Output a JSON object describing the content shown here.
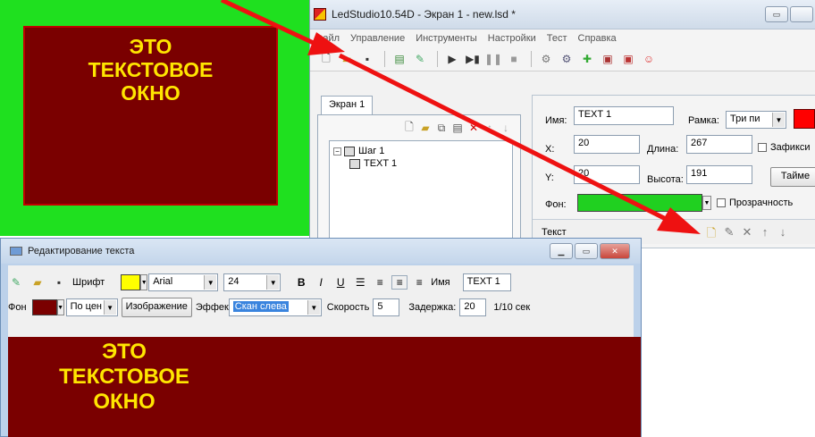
{
  "led_preview": {
    "lines": [
      "ЭТО",
      "ТЕКСТОВОЕ",
      "ОКНО"
    ],
    "colors": {
      "border_bg": "#1fe01f",
      "screen_bg": "#7a0000",
      "text": "#ffe600"
    }
  },
  "main_window": {
    "title": "LedStudio10.54D - Экран 1 - new.lsd *",
    "menu": [
      "Файл",
      "Управление",
      "Инструменты",
      "Настройки",
      "Тест",
      "Справка"
    ],
    "toolbar_icons": [
      "new-file-icon",
      "open-folder-icon",
      "save-icon",
      "screen-icon",
      "edit-icon",
      "play-icon",
      "step-icon",
      "pause-icon",
      "stop-icon",
      "tool-1-icon",
      "tool-2-icon",
      "tool-3-icon",
      "tool-4-icon",
      "tool-5-icon",
      "smiley-icon"
    ],
    "screen_tab": "Экран 1",
    "tree": {
      "step": "Шаг 1",
      "item": "TEXT 1"
    },
    "props": {
      "name_label": "Имя:",
      "name_value": "TEXT 1",
      "frame_label": "Рамка:",
      "frame_value": "Три пи",
      "x_label": "X:",
      "x_value": "20",
      "length_label": "Длина:",
      "length_value": "267",
      "fix_label": "Зафикси",
      "y_label": "Y:",
      "y_value": "20",
      "height_label": "Высота:",
      "height_value": "191",
      "timer_label": "Тайме",
      "bg_label": "Фон:",
      "bg_color": "#20d020",
      "transparency_label": "Прозрачность",
      "text_label": "Текст"
    }
  },
  "edit_window": {
    "title": "Редактирование текста",
    "font_label": "Шрифт",
    "font_color": "#ffff00",
    "font_name": "Arial",
    "font_size": "24",
    "bold": "B",
    "italic": "I",
    "underline": "U",
    "name_label": "Имя",
    "name_value": "TEXT 1",
    "bg_label": "Фон",
    "bg_color": "#7a0000",
    "align_value": "По цен",
    "image_button": "Изображение",
    "effect_label": "Эффек",
    "effect_value": "Скан слева",
    "speed_label": "Скорость",
    "speed_value": "5",
    "delay_label": "Задержка:",
    "delay_value": "20",
    "delay_unit": "1/10 сек",
    "preview_lines": [
      "ЭТО",
      "ТЕКСТОВОЕ",
      "ОКНО"
    ]
  }
}
